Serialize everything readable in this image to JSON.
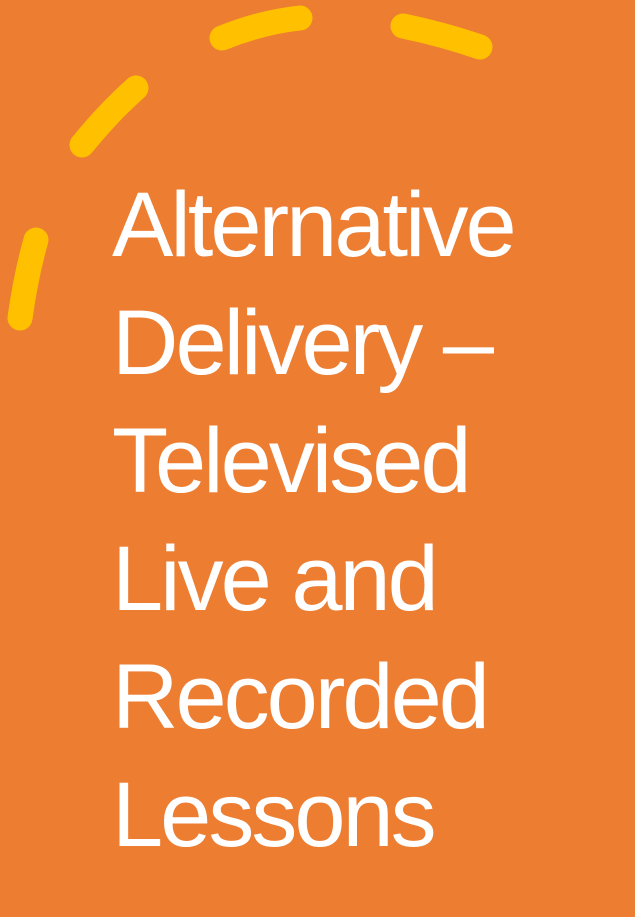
{
  "slide": {
    "background_color": "#ED7D31",
    "accent_color": "#FFC000",
    "text_color": "#FFFFFF",
    "decoration": "dashed-arc",
    "title_lines": [
      "Alternative",
      "Delivery –",
      "Televised",
      "Live and",
      "Recorded",
      "Lessons"
    ]
  }
}
